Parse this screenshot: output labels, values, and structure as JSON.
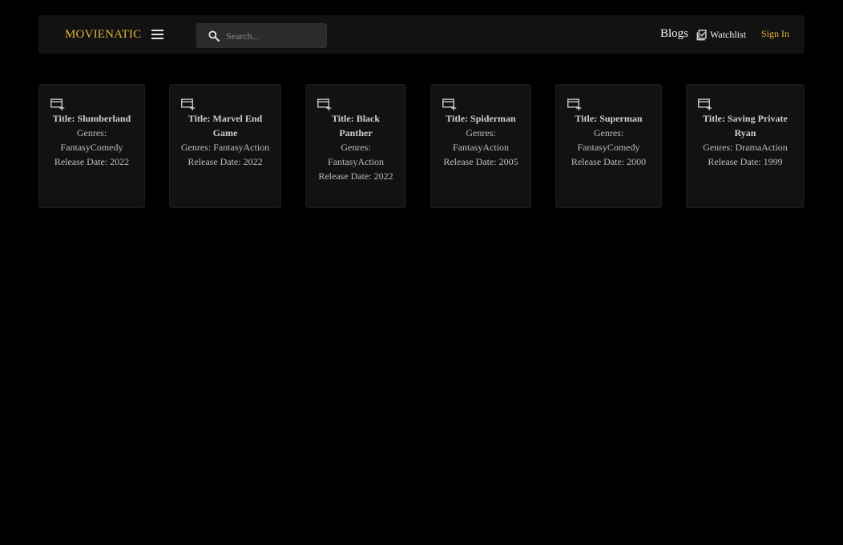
{
  "brand": "MOVIENATIC",
  "search": {
    "placeholder": "Search..."
  },
  "nav": {
    "blogs": "Blogs",
    "watchlist": "Watchlist",
    "signin": "Sign In"
  },
  "movies": [
    {
      "title": "Title: Slumberland",
      "genres": "Genres: FantasyComedy",
      "release": "Release Date: 2022"
    },
    {
      "title": "Title: Marvel End Game",
      "genres": "Genres: FantasyAction",
      "release": "Release Date: 2022"
    },
    {
      "title": "Title: Black Panther",
      "genres": "Genres: FantasyAction",
      "release": "Release Date: 2022"
    },
    {
      "title": "Title: Spiderman",
      "genres": "Genres: FantasyAction",
      "release": "Release Date: 2005"
    },
    {
      "title": "Title: Superman",
      "genres": "Genres: FantasyComedy",
      "release": "Release Date: 2000"
    },
    {
      "title": "Title: Saving Private Ryan",
      "genres": "Genres: DramaAction",
      "release": "Release Date: 1999"
    }
  ],
  "colors": {
    "accent": "#e4b43c",
    "background": "#000000",
    "surface": "#121212"
  },
  "icons": {
    "menu": "menu-icon",
    "search": "search-icon",
    "watchlist": "watchlist-check-icon",
    "card_action": "add-to-watchlist-icon"
  }
}
